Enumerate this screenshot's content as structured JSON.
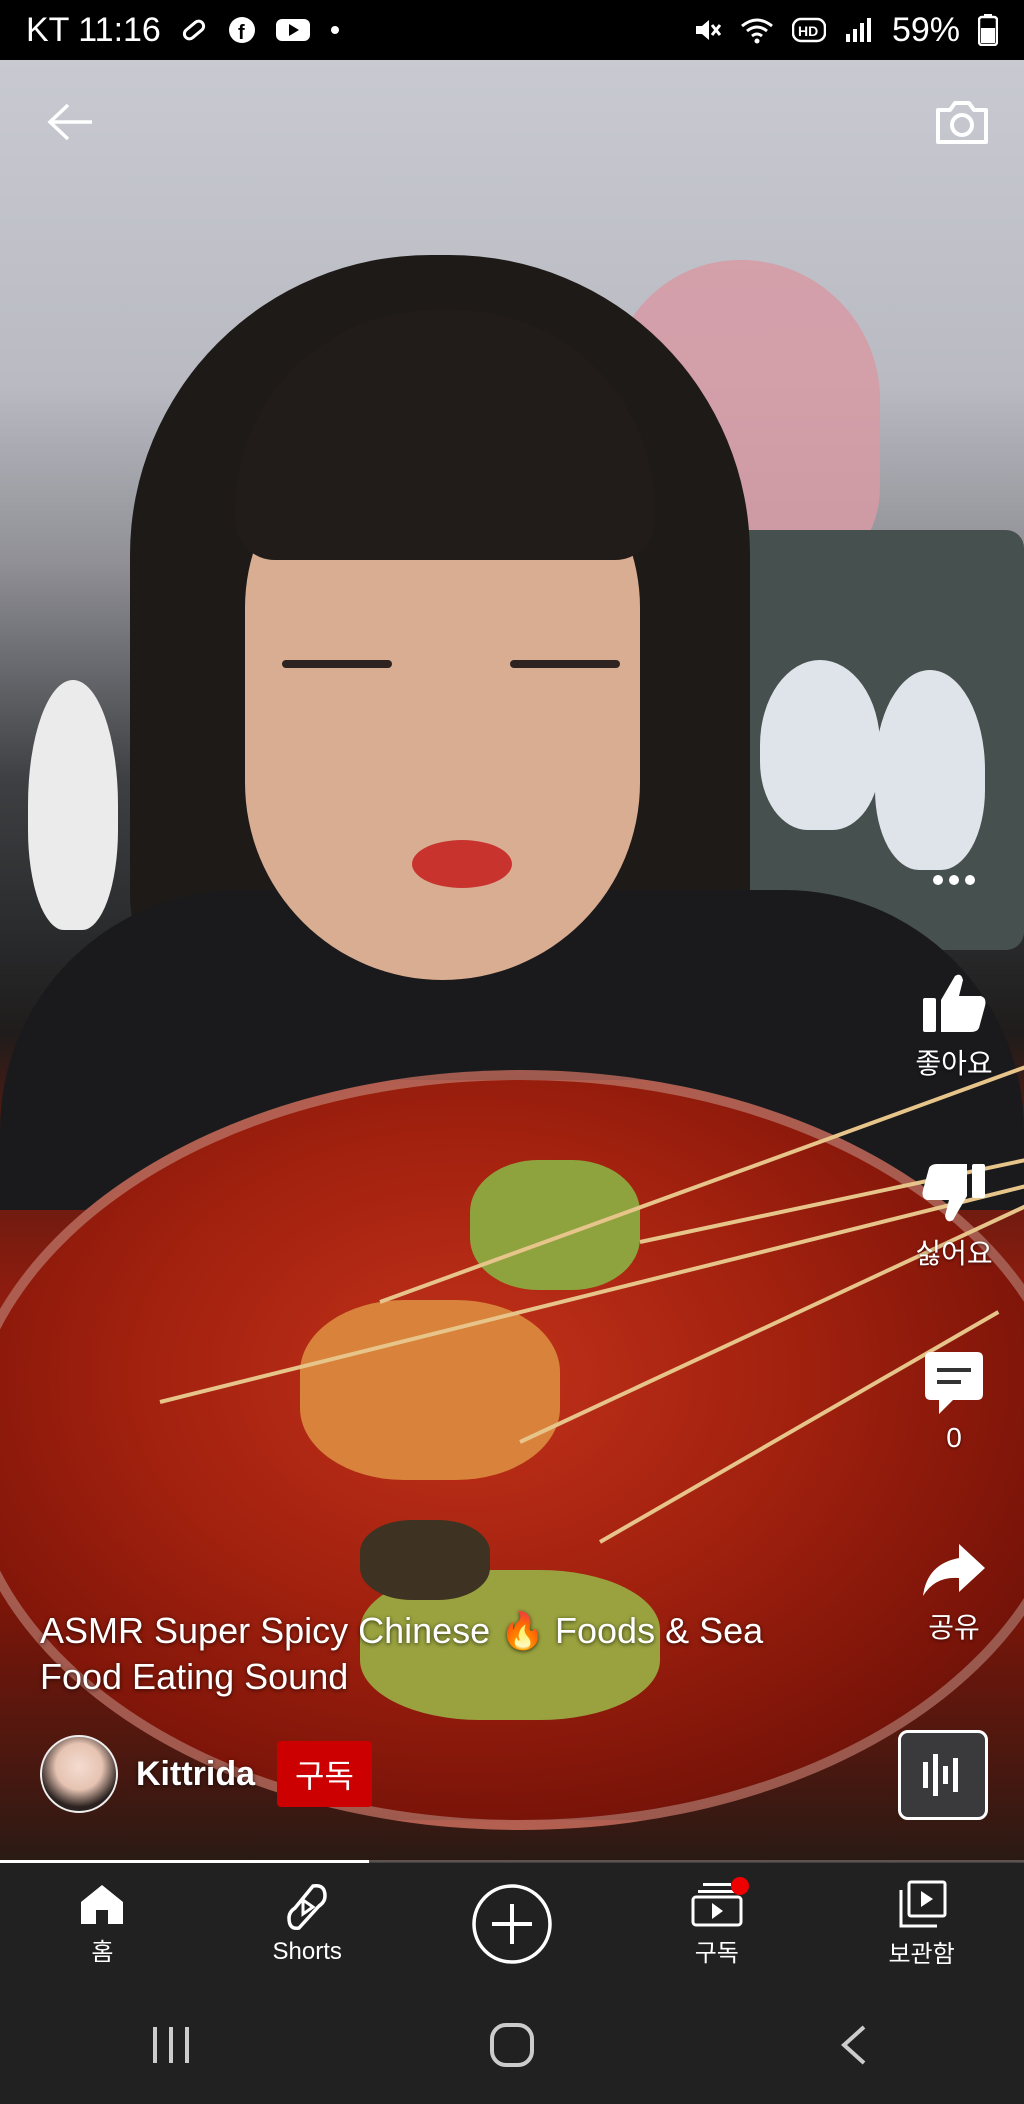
{
  "status_bar": {
    "carrier_time": "KT 11:16",
    "battery": "59%",
    "icons": [
      "bandage-icon",
      "facebook-icon",
      "youtube-icon",
      "dot-icon",
      "mute-icon",
      "wifi-icon",
      "hd-icon",
      "signal-icon",
      "battery-icon"
    ]
  },
  "video": {
    "title": "ASMR Super Spicy Chinese 🔥 Foods & Sea Food Eating Sound",
    "channel_name": "Kittrida",
    "subscribe_label": "구독",
    "progress": 0.36
  },
  "actions": {
    "like_label": "좋아요",
    "dislike_label": "싫어요",
    "comments_count": "0",
    "share_label": "공유"
  },
  "bottom_nav": {
    "items": [
      {
        "label": "홈",
        "icon": "home-icon"
      },
      {
        "label": "Shorts",
        "icon": "shorts-icon"
      },
      {
        "label": "",
        "icon": "create-icon"
      },
      {
        "label": "구독",
        "icon": "subscriptions-icon"
      },
      {
        "label": "보관함",
        "icon": "library-icon"
      }
    ]
  },
  "colors": {
    "subscribe_red": "#cc0000",
    "nav_bg": "#212121"
  }
}
